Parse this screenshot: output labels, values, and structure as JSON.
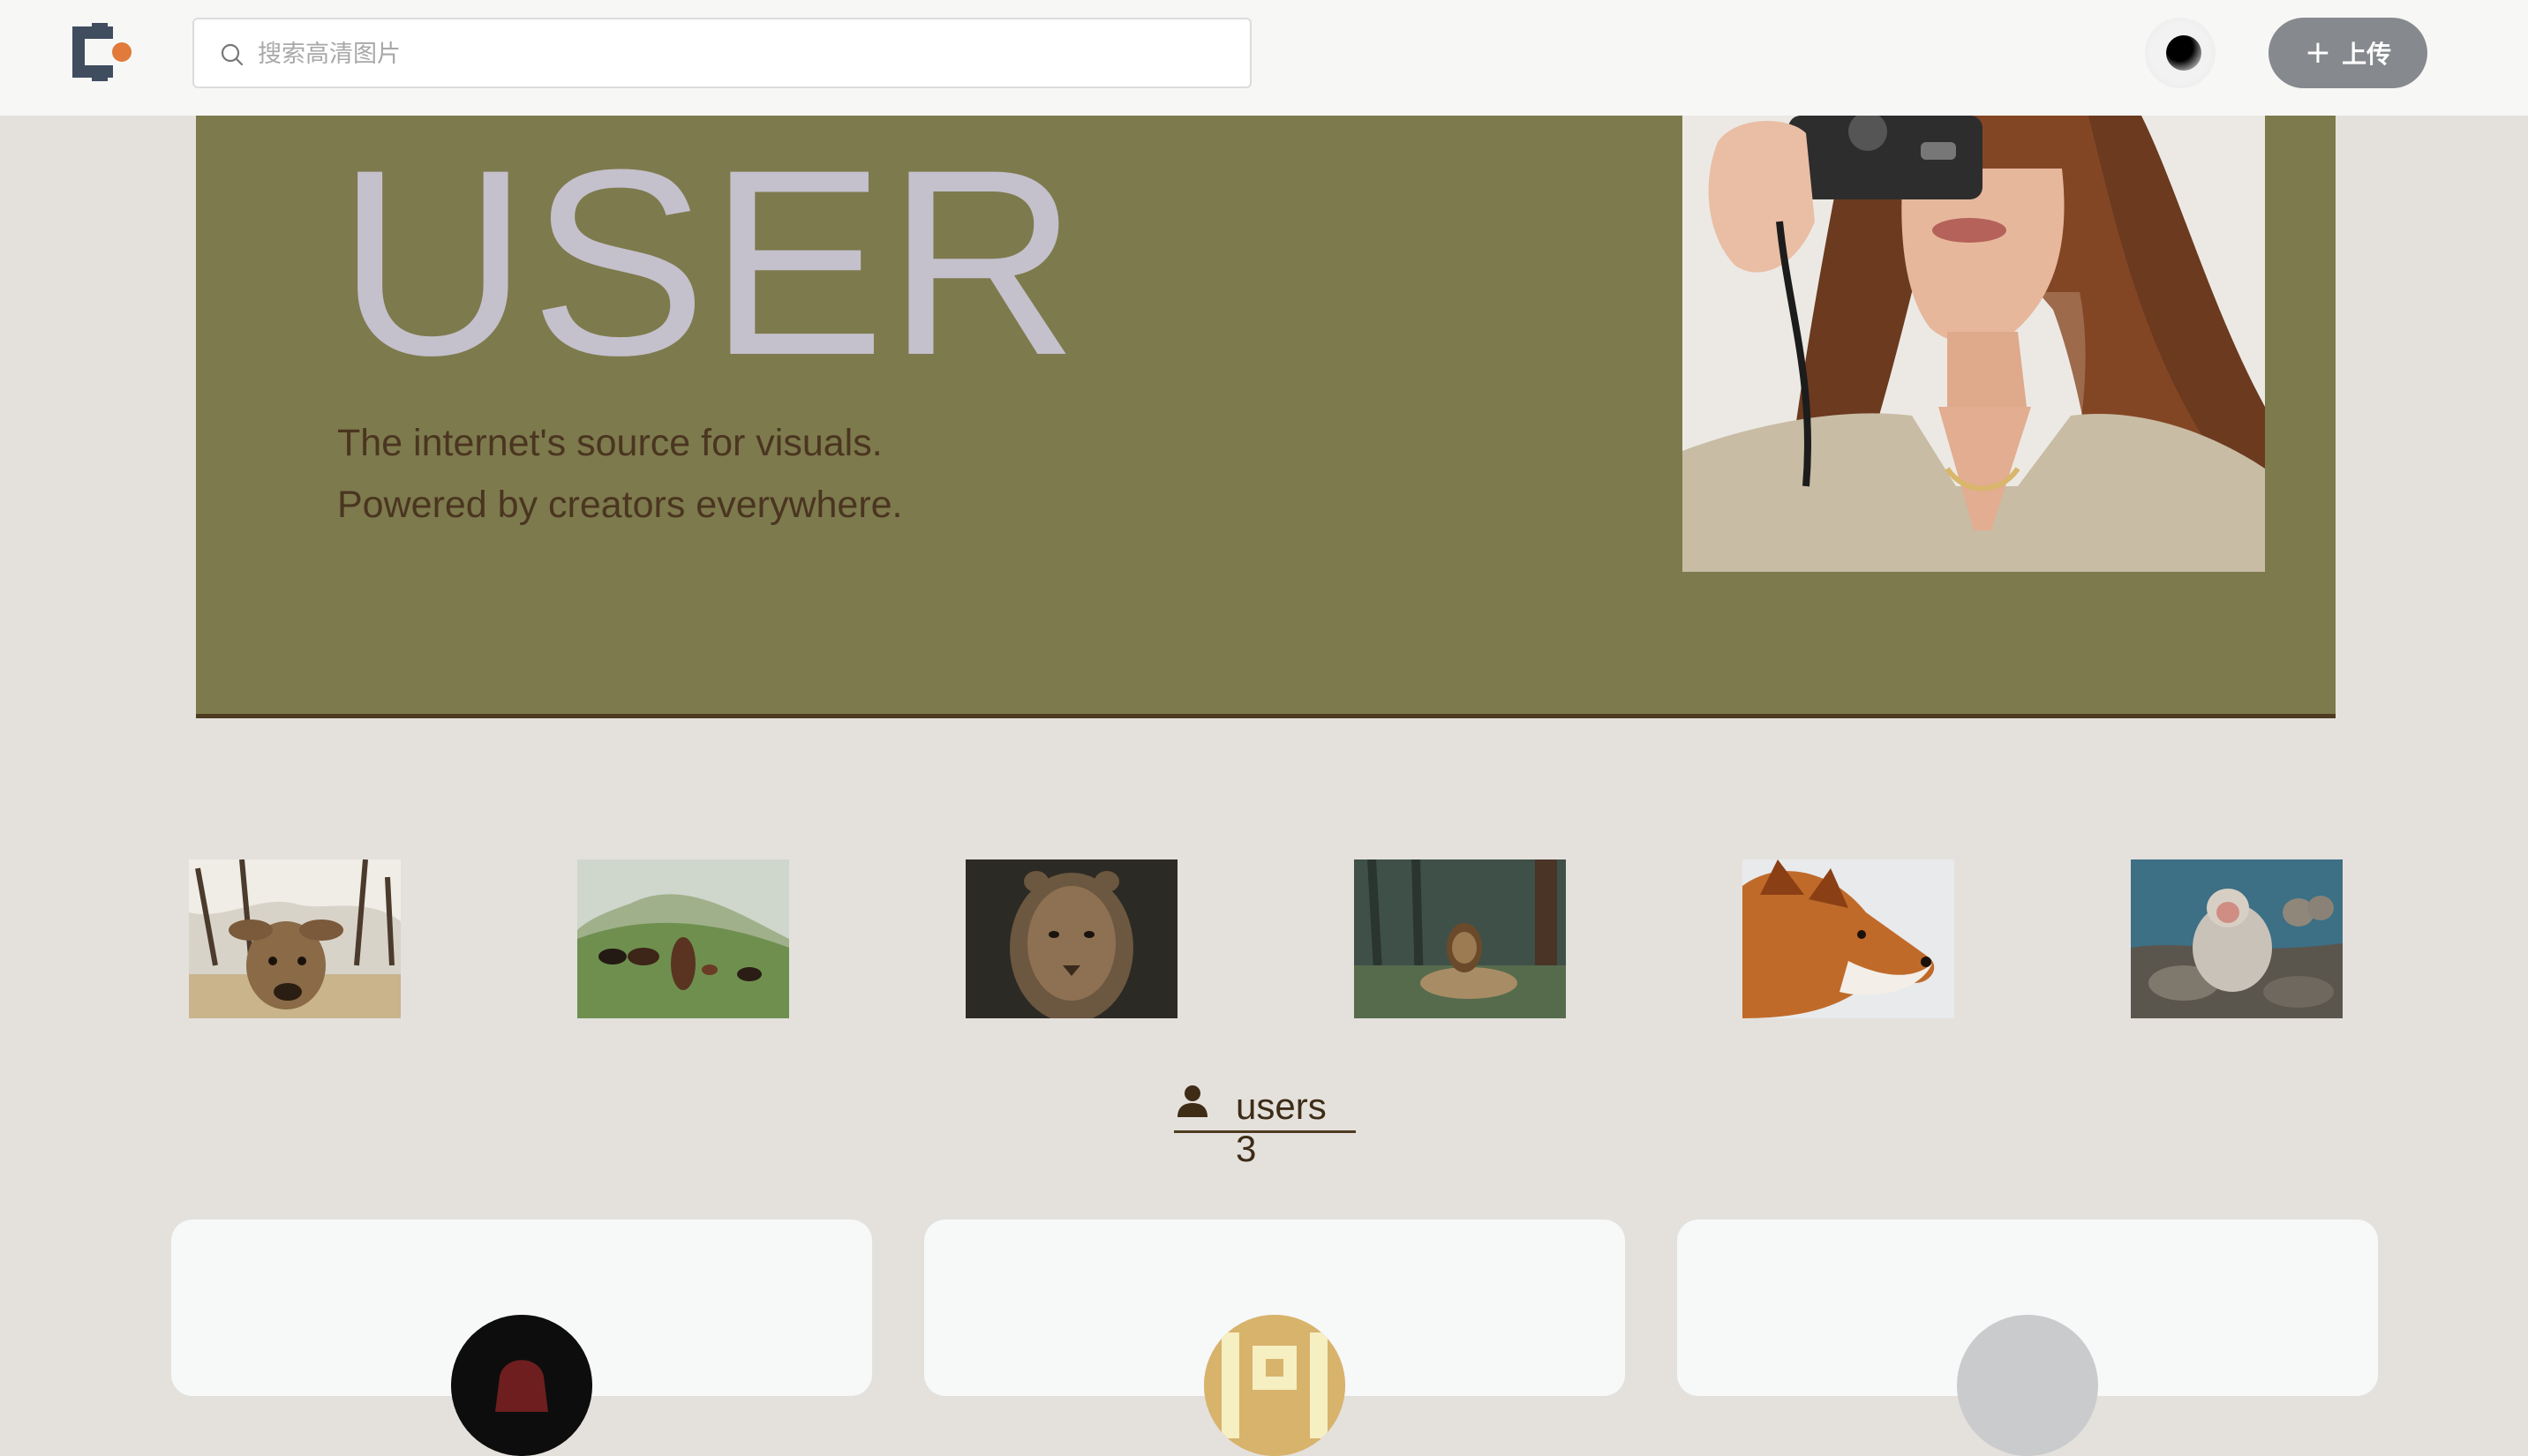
{
  "header": {
    "logo": "brand-logo",
    "search_placeholder": "搜索高清图片",
    "upload_label": "上传",
    "upload_icon": "plus-icon",
    "search_icon": "search-icon",
    "avatar_icon": "user-avatar"
  },
  "hero": {
    "title": "USER",
    "subtitle_line1": "The internet's source for visuals.",
    "subtitle_line2": "Powered by creators everywhere.",
    "background_color": "#7d7a4d",
    "photo": "woman-holding-camera-photo"
  },
  "thumbnails": [
    {
      "name": "deer-photo"
    },
    {
      "name": "horses-photo"
    },
    {
      "name": "lioness-photo"
    },
    {
      "name": "lion-in-forest-photo"
    },
    {
      "name": "fox-photo"
    },
    {
      "name": "snow-monkey-photo"
    }
  ],
  "users_tab": {
    "label": "users",
    "count": "3",
    "icon": "user-icon"
  },
  "user_cards": [
    {
      "avatar": "dark-red-avatar"
    },
    {
      "avatar": "pattern-avatar"
    },
    {
      "avatar": "default-grey-avatar"
    }
  ],
  "colors": {
    "page_bg": "#e4e1dd",
    "hero_bg": "#7d7a4d",
    "accent_dark": "#4e3b20",
    "upload_button": "#86898d"
  }
}
